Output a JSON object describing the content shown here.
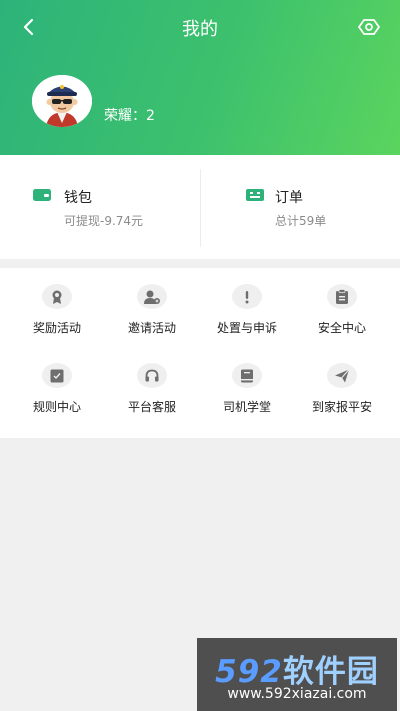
{
  "header": {
    "title": "我的",
    "user_name": "",
    "honor": "荣耀：2"
  },
  "stats": {
    "wallet": {
      "label": "钱包",
      "sub": "可提现-9.74元"
    },
    "orders": {
      "label": "订单",
      "sub": "总计59单"
    }
  },
  "grid": {
    "items": [
      {
        "label": "奖励活动",
        "icon": "medal-icon"
      },
      {
        "label": "邀请活动",
        "icon": "invite-user-icon"
      },
      {
        "label": "处置与申诉",
        "icon": "exclamation-icon"
      },
      {
        "label": "安全中心",
        "icon": "clipboard-icon"
      },
      {
        "label": "规则中心",
        "icon": "rules-icon"
      },
      {
        "label": "平台客服",
        "icon": "headset-icon"
      },
      {
        "label": "司机学堂",
        "icon": "book-icon"
      },
      {
        "label": "到家报平安",
        "icon": "paper-plane-icon"
      }
    ]
  },
  "watermark": {
    "logo_num": "592",
    "logo_text": "软件园",
    "url": "www.592xiazai.com"
  },
  "colors": {
    "header_start": "#2db37a",
    "header_end": "#5bd45e",
    "accent": "#2db37a",
    "icon_gray": "#6e6e6e"
  }
}
